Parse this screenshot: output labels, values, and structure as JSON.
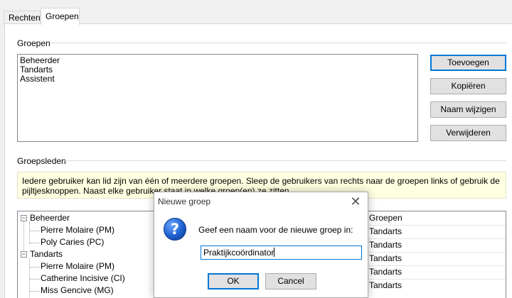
{
  "tabs": [
    {
      "label": "Rechten",
      "active": false
    },
    {
      "label": "Groepen",
      "active": true
    }
  ],
  "groups_section": {
    "title": "Groepen",
    "items": [
      "Beheerder",
      "Tandarts",
      "Assistent"
    ]
  },
  "buttons": {
    "add": "Toevoegen",
    "copy": "Kopiëren",
    "rename": "Naam wijzigen",
    "delete": "Verwijderen"
  },
  "members_section": {
    "title": "Groepsleden",
    "info": "Iedere gebruiker kan lid zijn van één of meerdere groepen. Sleep de gebruikers van rechts naar de groepen links of gebruik de pijltjesknoppen. Naast elke gebruiker staat in welke groep(en) ze zitten.",
    "tree": [
      {
        "label": "Beheerder",
        "type": "group",
        "expander": "⊟"
      },
      {
        "label": "Pierre Molaire (PM)",
        "type": "member"
      },
      {
        "label": "Poly Caries (PC)",
        "type": "member"
      },
      {
        "label": "Tandarts",
        "type": "group",
        "expander": "⊟"
      },
      {
        "label": "Pierre Molaire (PM)",
        "type": "member"
      },
      {
        "label": "Catherine Incisive (CI)",
        "type": "member"
      },
      {
        "label": "Miss Gencive (MG)",
        "type": "member"
      }
    ],
    "right_list": {
      "header": "Groepen",
      "rows": [
        "Tandarts",
        "Tandarts",
        "Tandarts",
        "Tandarts",
        "Tandarts"
      ]
    }
  },
  "dialog": {
    "title": "Nieuwe groep",
    "close_glyph": "✕",
    "icon_glyph": "?",
    "prompt": "Geef een naam voor de nieuwe groep in:",
    "input_value": "Praktijkcoördinator",
    "ok_label": "OK",
    "cancel_label": "Cancel"
  },
  "colors": {
    "accent": "#0078d7",
    "info_background": "#ffffe1"
  }
}
